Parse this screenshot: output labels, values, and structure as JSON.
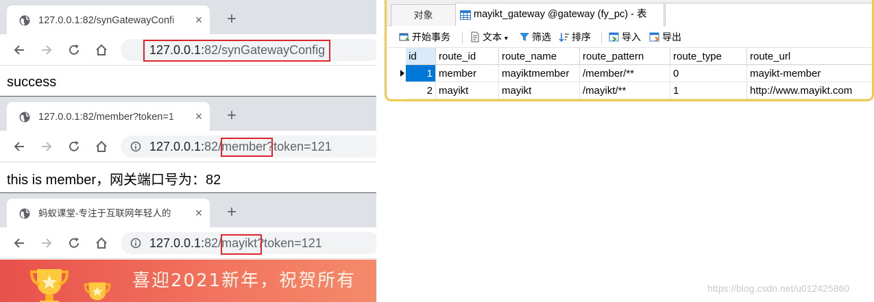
{
  "browsers": [
    {
      "tab_title": "127.0.0.1:82/synGatewayConfi",
      "new_tab": "+",
      "close": "×",
      "url_host": "127.0.0.1:",
      "url_rest": "82/synGatewayConfig",
      "body_text": "success"
    },
    {
      "tab_title": "127.0.0.1:82/member?token=1",
      "new_tab": "+",
      "close": "×",
      "url_host": "127.0.0.1:",
      "url_port": "82/",
      "url_path": "member",
      "url_query": "?token=121",
      "body_text": "this is member，网关端口号为：82"
    },
    {
      "tab_title": "蚂蚁课堂-专注于互联网年轻人的",
      "new_tab": "+",
      "close": "×",
      "url_host": "127.0.0.1:",
      "url_port": "82/",
      "url_path": "mayikt",
      "url_query": "?token=121",
      "banner_text": "喜迎2021新年，祝贺所有"
    }
  ],
  "navicat": {
    "tab_objects": "对象",
    "tab_table": "mayikt_gateway @gateway (fy_pc) - 表",
    "toolbar": {
      "begin_tx": "开始事务",
      "text": "文本",
      "filter": "筛选",
      "sort": "排序",
      "import": "导入",
      "export": "导出"
    },
    "columns": [
      "id",
      "route_id",
      "route_name",
      "route_pattern",
      "route_type",
      "route_url"
    ],
    "rows": [
      [
        "1",
        "member",
        "mayiktmember",
        "/member/**",
        "0",
        "mayikt-member"
      ],
      [
        "2",
        "mayikt",
        "mayikt",
        "/mayikt/**",
        "1",
        "http://www.mayikt.com"
      ]
    ]
  },
  "watermark": "https://blog.csdn.net/u012425860",
  "colors": {
    "highlight_box": "#e0242c",
    "panel_border": "#f2c94c",
    "selected_cell": "#0078d7"
  }
}
